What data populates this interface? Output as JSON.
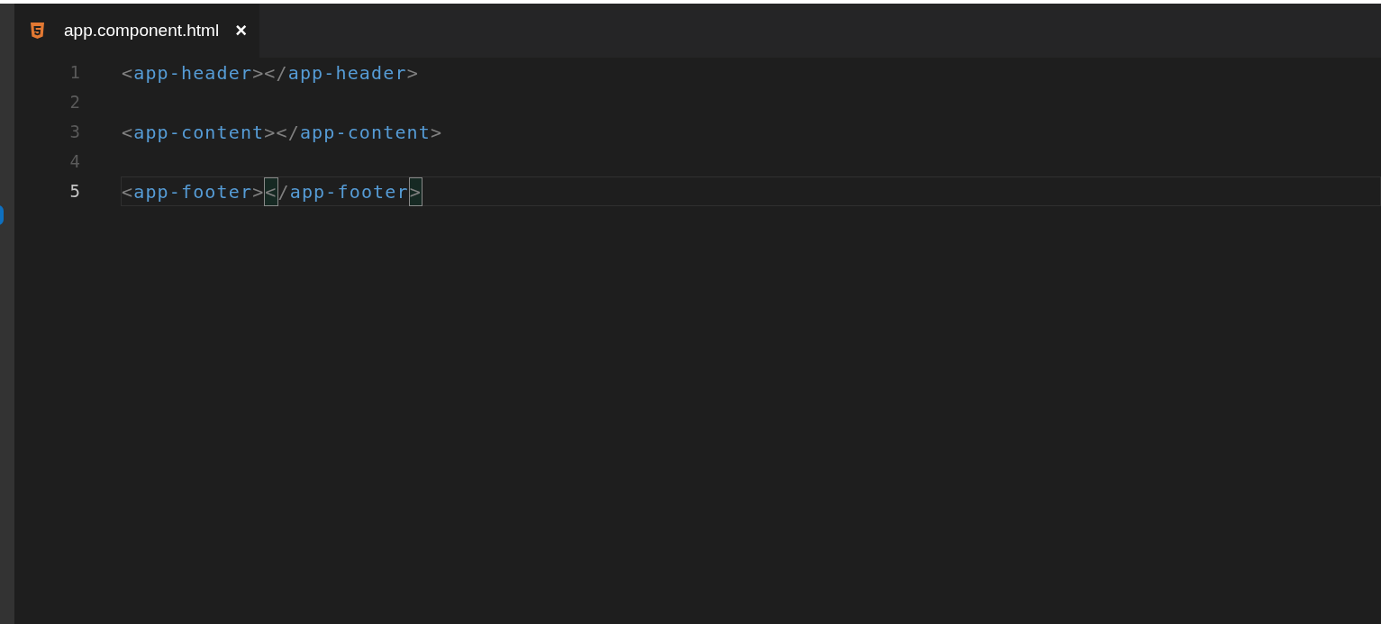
{
  "tabs": [
    {
      "label": "app.component.html",
      "selected": true,
      "close": "×"
    }
  ],
  "lines": [
    {
      "number": "1",
      "current": false,
      "tokens": [
        {
          "kind": "punct",
          "text": "<",
          "matched": false
        },
        {
          "kind": "tag",
          "text": "app-header"
        },
        {
          "kind": "punct",
          "text": "></",
          "matched": false
        },
        {
          "kind": "tag",
          "text": "app-header"
        },
        {
          "kind": "punct",
          "text": ">",
          "matched": false
        }
      ]
    },
    {
      "number": "2",
      "current": false
    },
    {
      "number": "3",
      "current": false,
      "tokens": [
        {
          "kind": "punct",
          "text": "<",
          "matched": false
        },
        {
          "kind": "tag",
          "text": "app-content"
        },
        {
          "kind": "punct",
          "text": "></",
          "matched": false
        },
        {
          "kind": "tag",
          "text": "app-content"
        },
        {
          "kind": "punct",
          "text": ">",
          "matched": false
        }
      ]
    },
    {
      "number": "4",
      "current": false
    },
    {
      "number": "5",
      "current": true,
      "tokens": [
        {
          "kind": "punct",
          "text": "<",
          "matched": false
        },
        {
          "kind": "tag",
          "text": "app-footer"
        },
        {
          "kind": "punct",
          "text": ">",
          "matched": false
        },
        {
          "kind": "punct",
          "text": "<",
          "matched": true
        },
        {
          "kind": "punct",
          "text": "/",
          "matched": false
        },
        {
          "kind": "tag",
          "text": "app-footer"
        },
        {
          "kind": "punct",
          "text": ">",
          "matched": true
        }
      ]
    }
  ]
}
